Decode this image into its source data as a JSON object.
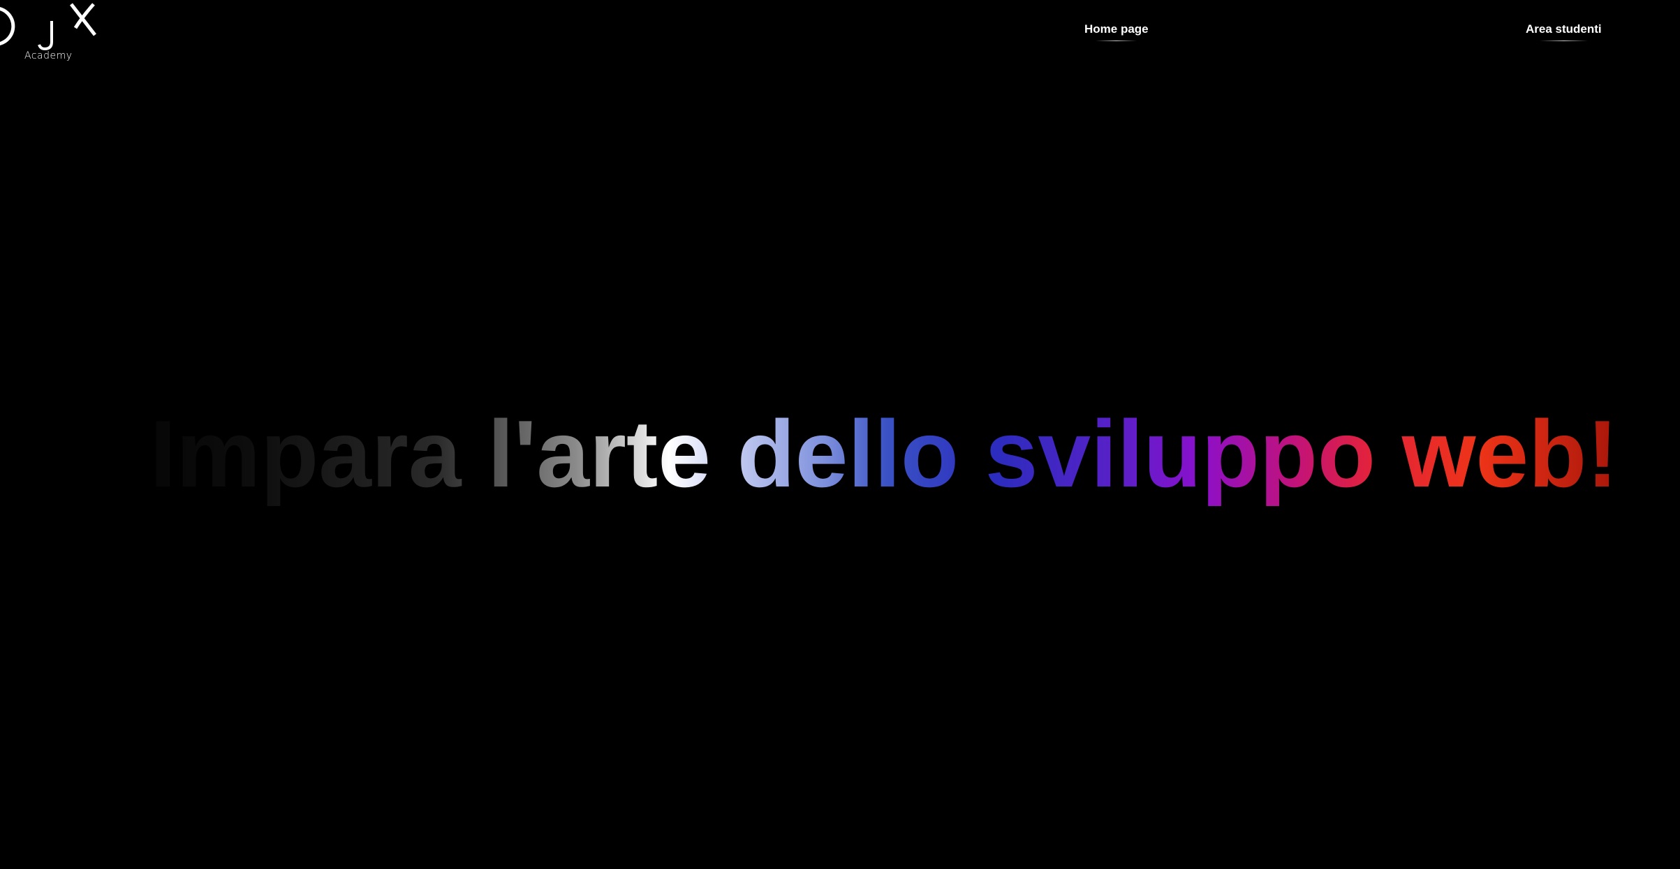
{
  "logo": {
    "mark": "JX",
    "subtitle": "Academy"
  },
  "nav": {
    "home_label": "Home page",
    "students_label": "Area studenti"
  },
  "hero": {
    "title": "Impara l'arte dello sviluppo web!"
  },
  "colors": {
    "background": "#000000",
    "text": "#ffffff",
    "gradient_stops": [
      "#000000",
      "#2a2a2a",
      "#ffffff",
      "#7e90dc",
      "#2c2cbe",
      "#8a10cc",
      "#e2223c",
      "#ee3418",
      "#a8160a"
    ]
  }
}
